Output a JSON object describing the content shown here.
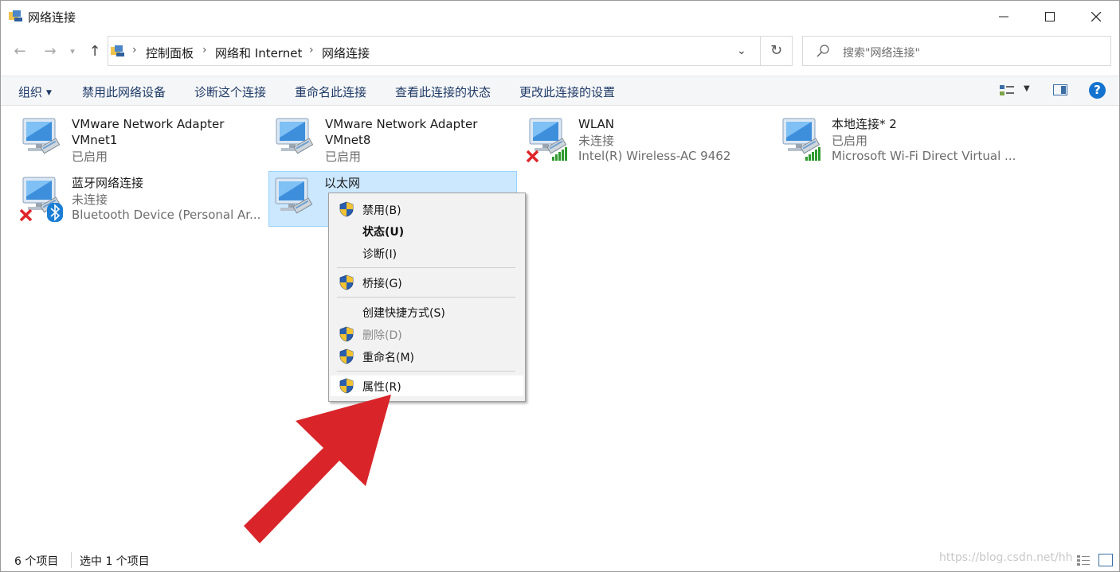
{
  "window": {
    "title": "网络连接"
  },
  "nav": {
    "breadcrumb": [
      "控制面板",
      "网络和 Internet",
      "网络连接"
    ],
    "search_placeholder": "搜索\"网络连接\""
  },
  "toolbar": {
    "organize": "组织",
    "commands": [
      "禁用此网络设备",
      "诊断这个连接",
      "重命名此连接",
      "查看此连接的状态",
      "更改此连接的设置"
    ],
    "help": "?"
  },
  "items": [
    {
      "name": "VMware Network Adapter VMnet1",
      "name_line1": "VMware Network Adapter",
      "name_line2": "VMnet1",
      "status": "已启用",
      "device": "",
      "badge": "none",
      "selected": false
    },
    {
      "name": "VMware Network Adapter VMnet8",
      "name_line1": "VMware Network Adapter",
      "name_line2": "VMnet8",
      "status": "已启用",
      "device": "",
      "badge": "none",
      "selected": false
    },
    {
      "name": "WLAN",
      "name_line1": "WLAN",
      "name_line2": "",
      "status": "未连接",
      "device": "Intel(R) Wireless-AC 9462",
      "badge": "red-x-signal",
      "selected": false
    },
    {
      "name": "本地连接* 2",
      "name_line1": "本地连接* 2",
      "name_line2": "",
      "status": "已启用",
      "device": "Microsoft Wi-Fi Direct Virtual ...",
      "badge": "signal",
      "selected": false
    },
    {
      "name": "蓝牙网络连接",
      "name_line1": "蓝牙网络连接",
      "name_line2": "",
      "status": "未连接",
      "device": "Bluetooth Device (Personal Ar...",
      "badge": "red-x-bluetooth",
      "selected": false
    },
    {
      "name": "以太网",
      "name_line1": "以太网",
      "name_line2": "",
      "status": "",
      "device": "",
      "badge": "none",
      "selected": true
    }
  ],
  "context_menu": [
    {
      "label": "禁用(B)",
      "shield": true,
      "bold": false,
      "disabled": false,
      "hot": false
    },
    {
      "label": "状态(U)",
      "shield": false,
      "bold": true,
      "disabled": false,
      "hot": false
    },
    {
      "label": "诊断(I)",
      "shield": false,
      "bold": false,
      "disabled": false,
      "hot": false
    },
    {
      "label": "桥接(G)",
      "shield": true,
      "bold": false,
      "disabled": false,
      "hot": false
    },
    {
      "label": "创建快捷方式(S)",
      "shield": false,
      "bold": false,
      "disabled": false,
      "hot": false
    },
    {
      "label": "删除(D)",
      "shield": true,
      "bold": false,
      "disabled": true,
      "hot": false
    },
    {
      "label": "重命名(M)",
      "shield": true,
      "bold": false,
      "disabled": false,
      "hot": false
    },
    {
      "label": "属性(R)",
      "shield": true,
      "bold": false,
      "disabled": false,
      "hot": true
    }
  ],
  "statusbar": {
    "count": "6 个项目",
    "selected": "选中 1 个项目"
  },
  "watermark": "https://blog.csdn.net/hh",
  "colors": {
    "accent": "#1473cf",
    "selection": "#cce8ff",
    "arrow": "#d9252a",
    "link_text": "#1e3a68"
  }
}
